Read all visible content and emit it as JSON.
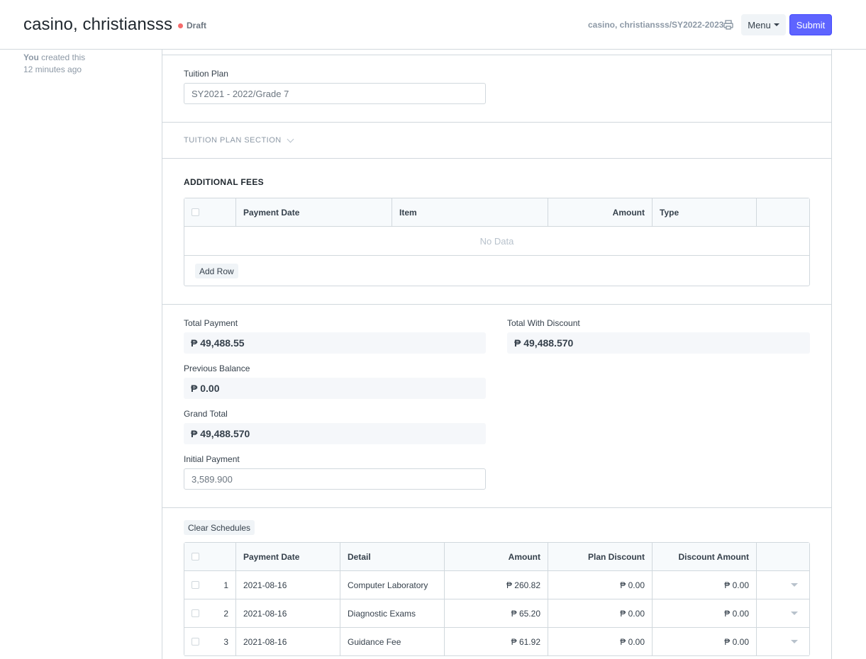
{
  "header": {
    "title": "casino, christiansss",
    "status": "Draft",
    "doc_path": "casino, christiansss/SY2022-2023",
    "menu_label": "Menu",
    "submit_label": "Submit"
  },
  "sidebar": {
    "creator": "You",
    "created_text": "created this",
    "created_when": "12 minutes ago"
  },
  "tuition": {
    "label": "Tuition Plan",
    "value": "SY2021 - 2022/Grade 7",
    "section_label": "TUITION PLAN SECTION"
  },
  "additional_fees": {
    "title": "ADDITIONAL FEES",
    "columns": [
      "Payment Date",
      "Item",
      "Amount",
      "Type"
    ],
    "empty_text": "No Data",
    "add_row_label": "Add Row"
  },
  "totals": {
    "total_payment_label": "Total Payment",
    "total_payment": "₱ 49,488.55",
    "total_with_discount_label": "Total With Discount",
    "total_with_discount": "₱ 49,488.570",
    "previous_balance_label": "Previous Balance",
    "previous_balance": "₱ 0.00",
    "grand_total_label": "Grand Total",
    "grand_total": "₱ 49,488.570",
    "initial_payment_label": "Initial Payment",
    "initial_payment": "3,589.900"
  },
  "schedules": {
    "clear_label": "Clear Schedules",
    "columns": [
      "Payment Date",
      "Detail",
      "Amount",
      "Plan Discount",
      "Discount Amount"
    ],
    "rows": [
      {
        "no": "1",
        "date": "2021-08-16",
        "detail": "Computer Laboratory",
        "amount": "₱ 260.82",
        "plan_discount": "₱ 0.00",
        "discount_amount": "₱ 0.00"
      },
      {
        "no": "2",
        "date": "2021-08-16",
        "detail": "Diagnostic Exams",
        "amount": "₱ 65.20",
        "plan_discount": "₱ 0.00",
        "discount_amount": "₱ 0.00"
      },
      {
        "no": "3",
        "date": "2021-08-16",
        "detail": "Guidance Fee",
        "amount": "₱ 61.92",
        "plan_discount": "₱ 0.00",
        "discount_amount": "₱ 0.00"
      }
    ]
  },
  "icons": {
    "print": "printer-icon",
    "dropdown": "caret-down-icon"
  },
  "colors": {
    "primary": "#5e64ff",
    "draft_indicator": "#f56b6b",
    "border": "#d1d8dd"
  }
}
